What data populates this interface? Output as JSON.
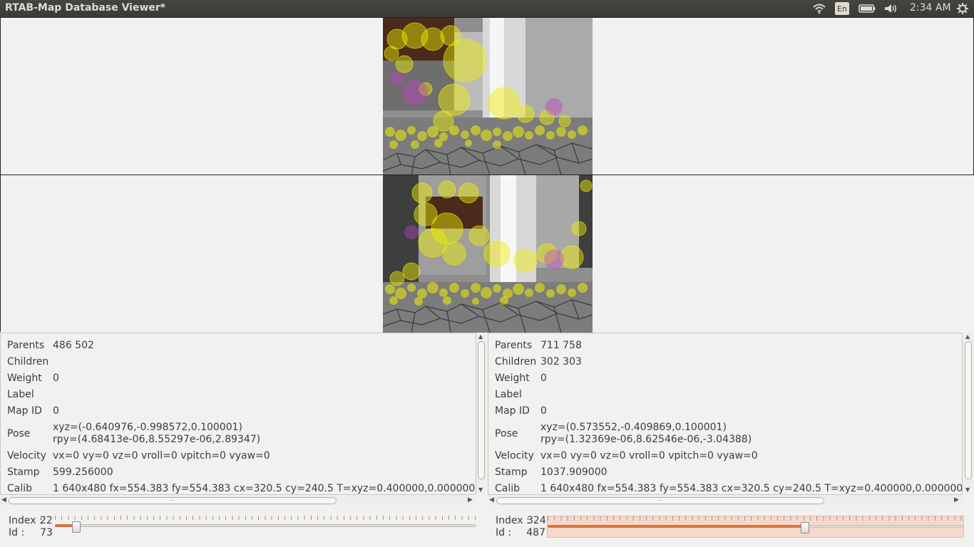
{
  "window": {
    "title": "RTAB-Map Database Viewer*"
  },
  "tray": {
    "wifi_icon": "wifi-icon",
    "language": "En",
    "battery_icon": "battery-icon",
    "volume_icon": "volume-icon",
    "time": "2:34 AM",
    "settings_icon": "gear-icon"
  },
  "colors": {
    "accent": "#e0703e",
    "feature": "#f0f000",
    "feature_magenta": "#c040c0",
    "panel": "#f2f1f0"
  },
  "left": {
    "parents_label": "Parents",
    "parents": "486 502",
    "children_label": "Children",
    "children": "",
    "weight_label": "Weight",
    "weight": "0",
    "label_label": "Label",
    "label": "",
    "mapid_label": "Map ID",
    "mapid": "0",
    "pose_label": "Pose",
    "pose_xyz": "xyz=(-0.640976,-0.998572,0.100001)",
    "pose_rpy": "rpy=(4.68413e-06,8.55297e-06,2.89347)",
    "velocity_label": "Velocity",
    "velocity": "vx=0 vy=0 vz=0 vroll=0 vpitch=0 vyaw=0",
    "stamp_label": "Stamp",
    "stamp": "599.256000",
    "calib_label": "Calib",
    "calib": "1 640x480 fx=554.383 fy=554.383 cx=320.5 cy=240.5 T=xyz=0.400000,0.000000,0.00000",
    "index_label": "Index :",
    "index": "22",
    "id_label": "Id :",
    "id": "73",
    "slider_fraction": 0.05
  },
  "right": {
    "parents_label": "Parents",
    "parents": "711 758",
    "children_label": "Children",
    "children": "302 303",
    "weight_label": "Weight",
    "weight": "0",
    "label_label": "Label",
    "label": "",
    "mapid_label": "Map ID",
    "mapid": "0",
    "pose_label": "Pose",
    "pose_xyz": "xyz=(0.573552,-0.409869,0.100001)",
    "pose_rpy": "rpy=(1.32369e-06,8.62546e-06,-3.04388)",
    "velocity_label": "Velocity",
    "velocity": "vx=0 vy=0 vz=0 vroll=0 vpitch=0 vyaw=0",
    "stamp_label": "Stamp",
    "stamp": "1037.909000",
    "calib_label": "Calib",
    "calib": "1 640x480 fx=554.383 fy=554.383 cx=320.5 cy=240.5 T=xyz=0.400000,0.000000,0.00000",
    "index_label": "Index :",
    "index": "324",
    "id_label": "Id :",
    "id": "487",
    "slider_fraction": 0.62
  }
}
